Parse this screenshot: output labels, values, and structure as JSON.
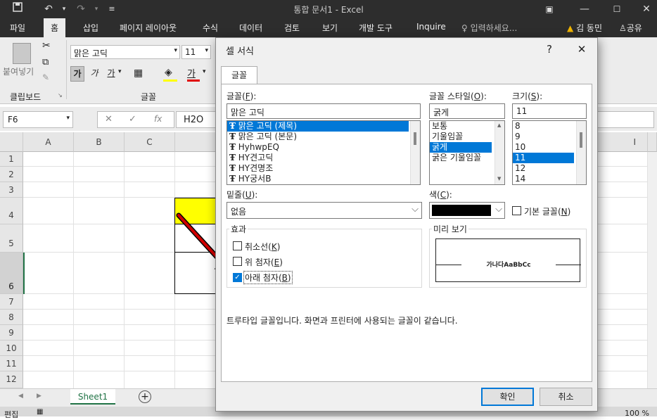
{
  "window": {
    "title": "통합 문서1 - Excel"
  },
  "tabs": [
    "파일",
    "홈",
    "삽입",
    "페이지 레이아웃",
    "수식",
    "데이터",
    "검토",
    "보기",
    "개발 도구",
    "Inquire"
  ],
  "active_tab": "홈",
  "tell_me": "입력하세요...",
  "user": {
    "name": "김 동민",
    "share": "공유"
  },
  "ribbon": {
    "paste_label": "붙여넣기",
    "clipboard_group": "클립보드",
    "font_group": "글꼴",
    "font_name": "맑은 고딕",
    "font_size": "11",
    "bold": "가",
    "italic": "가",
    "underline": "가",
    "font_color_glyph": "가"
  },
  "formula_bar": {
    "name_box": "F6",
    "fx": "fx",
    "value": "H2O"
  },
  "columns": [
    "A",
    "B",
    "C",
    "I"
  ],
  "rows": [
    "1",
    "2",
    "3",
    "4",
    "5",
    "6",
    "7",
    "8",
    "9",
    "10",
    "11",
    "12"
  ],
  "sheet_tab": "Sheet1",
  "status": {
    "mode": "편집",
    "zoom": "100 %"
  },
  "dialog": {
    "title": "셀 서식",
    "help": "?",
    "close": "✕",
    "tab": "글꼴",
    "font_label": "글꼴(",
    "font_key": "F",
    "font_value": "맑은 고딕",
    "font_list": [
      "맑은 고딕 (제목)",
      "맑은 고딕 (본문)",
      "HyhwpEQ",
      "HY견고딕",
      "HY견명조",
      "HY궁서B"
    ],
    "style_label": "글꼴 스타일(",
    "style_key": "O",
    "style_value": "굵게",
    "style_list": [
      "보통",
      "기울임꼴",
      "굵게",
      "굵은 기울임꼴"
    ],
    "size_label": "크기(",
    "size_key": "S",
    "size_value": "11",
    "size_list": [
      "8",
      "9",
      "10",
      "11",
      "12",
      "14"
    ],
    "underline_label": "밑줄(",
    "underline_key": "U",
    "underline_value": "없음",
    "color_label": "색(",
    "color_key": "C",
    "color_value": "#000000",
    "normal_font": "기본 글꼴(",
    "normal_font_key": "N",
    "effects_label": "효과",
    "strike": "취소선(",
    "strike_key": "K",
    "superscript": "위 첨자(",
    "superscript_key": "E",
    "subscript": "아래 첨자(",
    "subscript_key": "B",
    "preview_label": "미리 보기",
    "preview_text": "가나다AaBbCc",
    "note": "트루타입 글꼴입니다. 화면과 프린터에 사용되는 글꼴이 같습니다.",
    "ok": "확인",
    "cancel": "취소"
  },
  "colors": {
    "accent": "#0078d7",
    "highlight": "#ffff00",
    "arrow": "#d00000",
    "titlebar": "#2d2d2d"
  }
}
